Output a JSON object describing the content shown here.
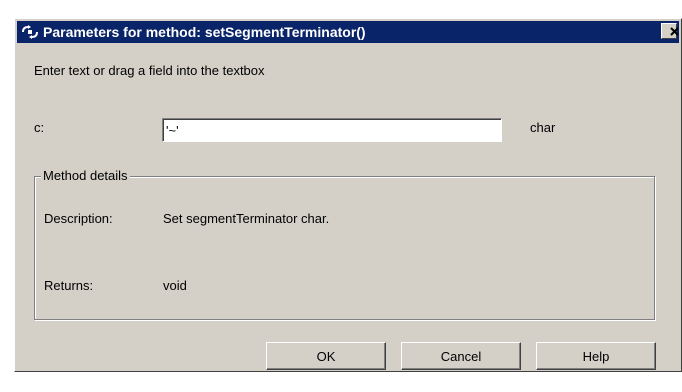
{
  "window": {
    "title": "Parameters for method: setSegmentTerminator()",
    "icon": "parameters-icon",
    "close_icon": "close-icon"
  },
  "prompt": "Enter text or drag a field into the textbox",
  "parameter": {
    "label": "c:",
    "value": "'~'",
    "type": "char"
  },
  "method_details": {
    "legend": "Method details",
    "description_label": "Description:",
    "description_value": "Set segmentTerminator char.",
    "returns_label": "Returns:",
    "returns_value": "void"
  },
  "buttons": {
    "ok": "OK",
    "cancel": "Cancel",
    "help": "Help"
  },
  "colors": {
    "titlebar": "#0a246a",
    "dialog_face": "#d4d0c8"
  }
}
